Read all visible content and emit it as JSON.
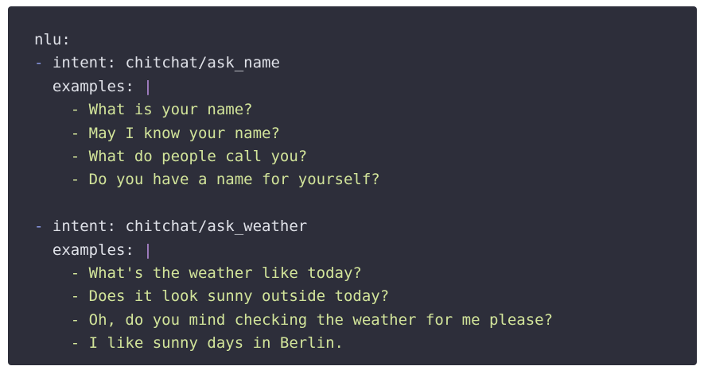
{
  "code": {
    "root_key": "nlu:",
    "intents": [
      {
        "dash": "-",
        "intent_key": "intent:",
        "intent_value": "chitchat/ask_name",
        "examples_key": "examples:",
        "pipe": "|",
        "examples": [
          "What is your name?",
          "May I know your name?",
          "What do people call you?",
          "Do you have a name for yourself?"
        ]
      },
      {
        "dash": "-",
        "intent_key": "intent:",
        "intent_value": "chitchat/ask_weather",
        "examples_key": "examples:",
        "pipe": "|",
        "examples": [
          "What's the weather like today?",
          "Does it look sunny outside today?",
          "Oh, do you mind checking the weather for me please?",
          "I like sunny days in Berlin."
        ]
      }
    ],
    "item_dash": "-"
  }
}
